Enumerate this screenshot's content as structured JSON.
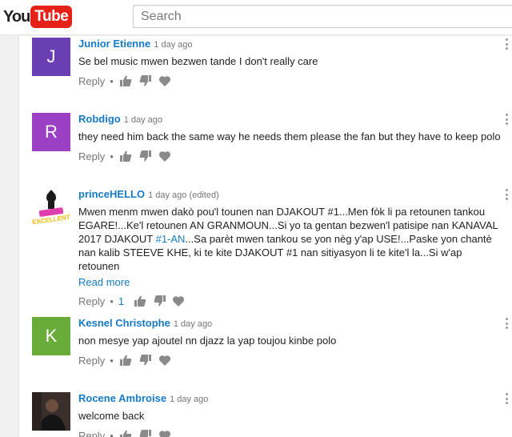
{
  "header": {
    "logo_you": "You",
    "logo_tube": "Tube",
    "search_placeholder": "Search"
  },
  "comments": [
    {
      "author": "Junior Etienne",
      "time": "1 day ago",
      "text": "Se bel music mwen bezwen tande I don't really care",
      "avatar_letter": "J",
      "avatar_color": "#6a3fb4",
      "reply_label": "Reply",
      "dot": "•"
    },
    {
      "author": "Robdigo",
      "time": "1 day ago",
      "text": "they need him back the same way he needs them please the fan but they have to keep polo",
      "avatar_letter": "R",
      "avatar_color": "#9b3fc4",
      "reply_label": "Reply",
      "dot": "•"
    },
    {
      "author": "princeHELLO",
      "time": "1 day ago (edited)",
      "text_before_link": "Mwen menm mwen dakò pou'l tounen nan DJAKOUT #1...Men fòk li pa retounen tankou EGARE!...Ke'l retounen AN GRANMOUN...Si yo ta gentan bezwen'l patisipe nan KANAVAL 2017 DJAKOUT ",
      "link": "#1-AN",
      "text_after_link": "...Sa parèt mwen tankou se yon nèg y'ap USE!...Paske yon chantè nan kalib STEEVE KHE,  ki te kite DJAKOUT #1 nan sitiyasyon li te kite'l la...Si w'ap retounen",
      "read_more": "Read more",
      "reply_label": "Reply",
      "dot": "•",
      "likes": "1",
      "avatar_logo_text": "EXCELLENT"
    },
    {
      "author": "Kesnel Christophe",
      "time": "1 day ago",
      "text": "non mesye yap ajoutel nn djazz la yap toujou kinbe polo",
      "avatar_letter": "K",
      "avatar_color": "#6aac3a",
      "reply_label": "Reply",
      "dot": "•"
    },
    {
      "author": "Rocene Ambroise",
      "time": "1 day ago",
      "text": "welcome back",
      "reply_label": "Reply",
      "dot": "•"
    }
  ]
}
